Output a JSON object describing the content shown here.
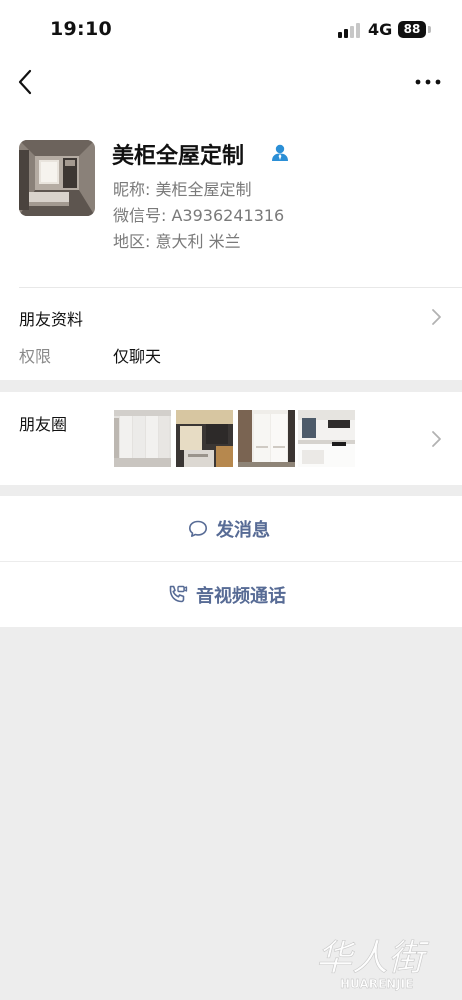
{
  "status_bar": {
    "time": "19:10",
    "network": "4G",
    "battery": "88"
  },
  "nav": {
    "back_icon": "chevron-left-icon",
    "more_icon": "more-dots-icon"
  },
  "profile": {
    "name": "美柜全屋定制",
    "badge_icon": "person-icon",
    "badge_color": "#2b8fd6",
    "nickname_label": "昵称: ",
    "nickname": "美柜全屋定制",
    "wechat_id_label": "微信号: ",
    "wechat_id": "A3936241316",
    "region_label": "地区: ",
    "region": "意大利 米兰"
  },
  "friend_info": {
    "title": "朋友资料"
  },
  "permission": {
    "label": "权限",
    "value": "仅聊天"
  },
  "moments": {
    "title": "朋友圈",
    "photo_count": 4
  },
  "actions": {
    "message_label": "发消息",
    "message_icon": "chat-bubble-icon",
    "call_label": "音视频通话",
    "call_icon": "phone-video-icon",
    "link_color": "#576b95"
  },
  "watermark": {
    "text": "华人街",
    "subtext": "HUARENJIE"
  }
}
